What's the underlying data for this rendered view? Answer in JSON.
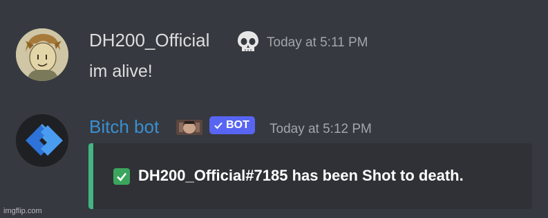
{
  "messages": [
    {
      "username": "DH200_Official",
      "username_color": "#dcddde",
      "timestamp": "Today at 5:11 PM",
      "content": "im alive!",
      "avatar_icon": "drawn-character-avatar",
      "badge_icon": "skull-emoji"
    },
    {
      "username": "Bitch bot",
      "username_color": "#3a8fd1",
      "timestamp": "Today at 5:12 PM",
      "avatar_icon": "blue-chevron-logo",
      "badge_icon": "small-image-emoji",
      "bot_tag": "BOT",
      "bot_tag_color": "#5865f2",
      "embed": {
        "accent_color": "#43b581",
        "check_color": "#3ba55d",
        "text": "DH200_Official#7185 has been Shot to death."
      }
    }
  ],
  "watermark": "imgflip.com",
  "colors": {
    "background": "#36393f",
    "embed_background": "#2f3136",
    "timestamp": "#a3a6aa",
    "text": "#dcddde"
  }
}
